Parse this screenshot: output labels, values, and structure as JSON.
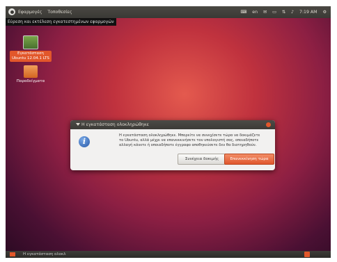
{
  "panel": {
    "menu": [
      "Εφαρμογές",
      "Τοποθεσίες"
    ],
    "tray": [
      "en",
      "7:19 AM"
    ]
  },
  "tooltip": "Εύρεση και εκτέλεση εγκατεστημένων εφαρμογών",
  "desktop": {
    "installer_label": "Εγκατάσταση Ubuntu 12.04.1 LTS",
    "folder_label": "Παραδείγματα"
  },
  "dialog": {
    "title": "Η εγκατάσταση ολοκληρώθηκε",
    "message": "Η εγκατάσταση ολοκληρώθηκε. Μπορείτε να συνεχίσετε τώρα να δοκιμάζετε το Ubuntu, αλλά μέχρι να επανεκκινήσετε τον υπολογιστή σας, οποιαδήποτε αλλαγή κάνετε ή οποιαδήποτε έγγραφο αποθηκεύσετε δεν θα διατηρηθούν.",
    "continue_label": "Συνέχεια δοκιμής",
    "restart_label": "Επανεκκίνηση τώρα"
  },
  "taskbar": {
    "task_label": "Η εγκατάσταση ολοκλ"
  },
  "colors": {
    "accent": "#e1562b",
    "panel_bg": "#3c3b37"
  }
}
